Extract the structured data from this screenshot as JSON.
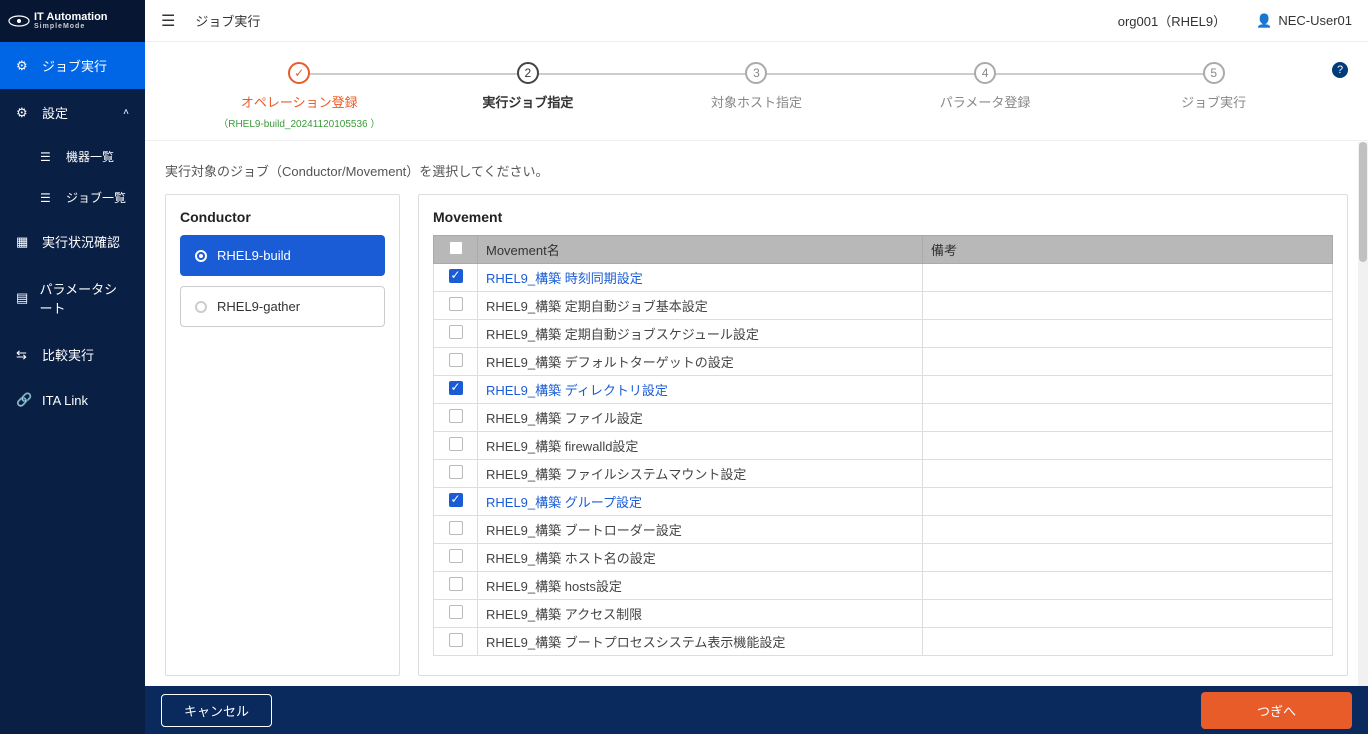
{
  "logo": {
    "main": "IT Automation",
    "sub": "SimpleMode"
  },
  "topbar": {
    "breadcrumb": "ジョブ実行",
    "org": "org001（RHEL9）",
    "user": "NEC-User01"
  },
  "sidebar": {
    "job_exec": "ジョブ実行",
    "settings": "設定",
    "sub": {
      "devices": "機器一覧",
      "jobs": "ジョブ一覧"
    },
    "status": "実行状況確認",
    "param_sheet": "パラメータシート",
    "compare": "比較実行",
    "ita_link": "ITA Link"
  },
  "steps": [
    {
      "num": "✓",
      "label": "オペレーション登録",
      "sub": "（RHEL9-build_20241120105536 ）",
      "state": "done"
    },
    {
      "num": "2",
      "label": "実行ジョブ指定",
      "state": "current"
    },
    {
      "num": "3",
      "label": "対象ホスト指定",
      "state": ""
    },
    {
      "num": "4",
      "label": "パラメータ登録",
      "state": ""
    },
    {
      "num": "5",
      "label": "ジョブ実行",
      "state": ""
    }
  ],
  "instruction": "実行対象のジョブ（Conductor/Movement）を選択してください。",
  "conductor": {
    "title": "Conductor",
    "items": [
      {
        "label": "RHEL9-build",
        "selected": true
      },
      {
        "label": "RHEL9-gather",
        "selected": false
      }
    ]
  },
  "movement": {
    "title": "Movement",
    "col_name": "Movement名",
    "col_remarks": "備考",
    "rows": [
      {
        "checked": true,
        "name": "RHEL9_構築 時刻同期設定"
      },
      {
        "checked": false,
        "name": "RHEL9_構築 定期自動ジョブ基本設定"
      },
      {
        "checked": false,
        "name": "RHEL9_構築 定期自動ジョブスケジュール設定"
      },
      {
        "checked": false,
        "name": "RHEL9_構築 デフォルトターゲットの設定"
      },
      {
        "checked": true,
        "name": "RHEL9_構築 ディレクトリ設定"
      },
      {
        "checked": false,
        "name": "RHEL9_構築 ファイル設定"
      },
      {
        "checked": false,
        "name": "RHEL9_構築 firewalld設定"
      },
      {
        "checked": false,
        "name": "RHEL9_構築 ファイルシステムマウント設定"
      },
      {
        "checked": true,
        "name": "RHEL9_構築 グループ設定"
      },
      {
        "checked": false,
        "name": "RHEL9_構築 ブートローダー設定"
      },
      {
        "checked": false,
        "name": "RHEL9_構築 ホスト名の設定"
      },
      {
        "checked": false,
        "name": "RHEL9_構築 hosts設定"
      },
      {
        "checked": false,
        "name": "RHEL9_構築 アクセス制限"
      },
      {
        "checked": false,
        "name": "RHEL9_構築 ブートプロセスシステム表示機能設定"
      }
    ]
  },
  "footer": {
    "cancel": "キャンセル",
    "next": "つぎへ"
  }
}
